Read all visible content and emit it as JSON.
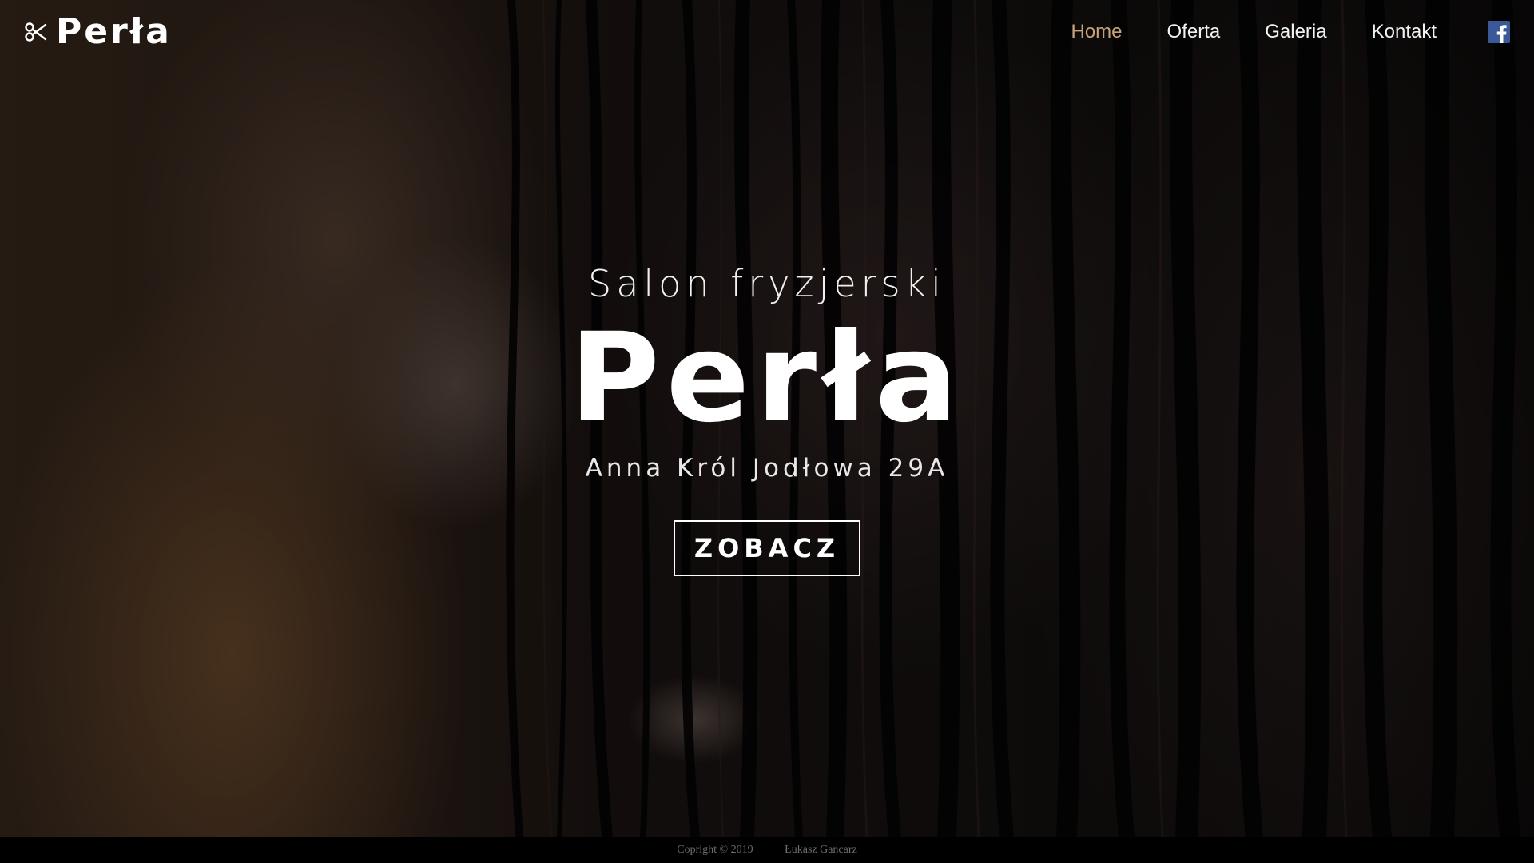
{
  "brand": {
    "name": "Perła",
    "logo_icon": "scissors-icon"
  },
  "nav": {
    "items": [
      {
        "label": "Home",
        "active": true
      },
      {
        "label": "Oferta",
        "active": false
      },
      {
        "label": "Galeria",
        "active": false
      },
      {
        "label": "Kontakt",
        "active": false
      }
    ],
    "social_icon": "facebook-icon"
  },
  "hero": {
    "subtitle": "Salon fryzjerski",
    "title": "Perła",
    "address": "Anna Król Jodłowa 29A",
    "cta_label": "ZOBACZ"
  },
  "footer": {
    "copyright": "Copright © 2019",
    "author": "Łukasz Gancarz"
  },
  "colors": {
    "accent": "#c9a27a",
    "facebook": "#3b5998",
    "text": "#ffffff",
    "footer_bg": "#000000",
    "footer_text": "#6e6e6e"
  }
}
